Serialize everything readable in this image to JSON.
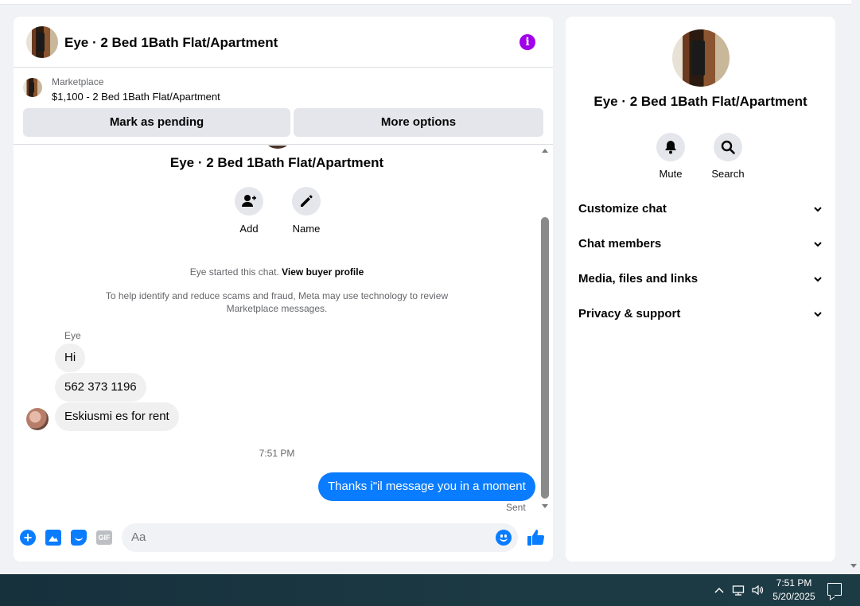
{
  "conversation": {
    "title": "Eye · 2 Bed 1Bath Flat/Apartment"
  },
  "marketplace": {
    "label": "Marketplace",
    "listing": "$1,100 - 2 Bed 1Bath Flat/Apartment",
    "mark_pending_label": "Mark as pending",
    "more_options_label": "More options"
  },
  "chat": {
    "title": "Eye · 2 Bed 1Bath Flat/Apartment",
    "actions": {
      "add_label": "Add",
      "name_label": "Name"
    },
    "started_text": "Eye started this chat.",
    "view_profile_link": "View buyer profile",
    "notice": "To help identify and reduce scams and fraud, Meta may use technology to review Marketplace messages.",
    "sender_name": "Eye",
    "incoming": [
      "Hi",
      "562 373 1196",
      "Eskiusmi es for rent"
    ],
    "time_separator": "7:51 PM",
    "outgoing": "Thanks i\"il message you in a moment",
    "status": "Sent"
  },
  "composer": {
    "placeholder": "Aa",
    "icons": [
      "plus-icon",
      "photo-icon",
      "sticker-icon",
      "gif-icon",
      "emoji-icon",
      "like-icon"
    ],
    "gif_text": "GIF"
  },
  "info_panel": {
    "title": "Eye · 2 Bed 1Bath Flat/Apartment",
    "mute_label": "Mute",
    "search_label": "Search",
    "sections": [
      "Customize chat",
      "Chat members",
      "Media, files and links",
      "Privacy & support"
    ]
  },
  "taskbar": {
    "time": "7:51 PM",
    "date": "5/20/2025"
  },
  "colors": {
    "accent": "#0a7cff",
    "info": "#a000e8",
    "bubble_in": "#f0f0f0",
    "secondary_text": "#65676b"
  }
}
